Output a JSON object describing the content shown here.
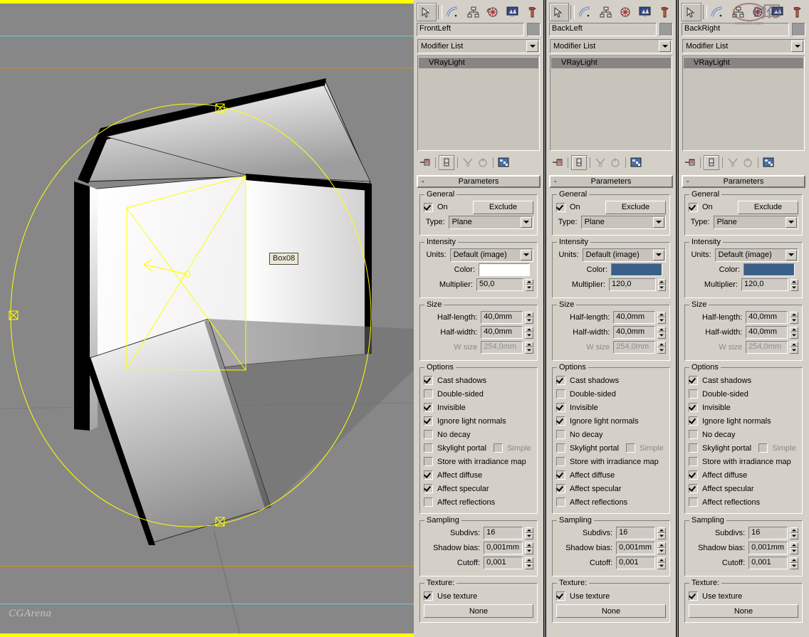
{
  "viewport": {
    "object_label": "Box08",
    "watermark": "CGArena",
    "background_color": "#878787",
    "border_color": "#ffff00",
    "safeframe_cyan": "#52d3d3",
    "safeframe_orange": "#c98f22",
    "gizmo_color": "#ffff00"
  },
  "watermark_overlay": {
    "text": "www.tt3.com",
    "alt": "chinese-site-watermark"
  },
  "toolbar": {
    "icons": [
      {
        "name": "create-panel-icon",
        "title": "Create"
      },
      {
        "name": "modify-panel-icon",
        "title": "Modify"
      },
      {
        "name": "hierarchy-panel-icon",
        "title": "Hierarchy"
      },
      {
        "name": "motion-panel-icon",
        "title": "Motion"
      },
      {
        "name": "display-panel-icon",
        "title": "Display"
      },
      {
        "name": "utilities-panel-icon",
        "title": "Utilities"
      }
    ]
  },
  "stack_toolbar": {
    "icons": [
      {
        "name": "pin-stack-icon",
        "title": "Pin Stack"
      },
      {
        "name": "show-end-result-icon",
        "title": "Show End Result"
      },
      {
        "name": "make-unique-icon",
        "title": "Make Unique"
      },
      {
        "name": "remove-modifier-icon",
        "title": "Remove Modifier"
      },
      {
        "name": "configure-modifier-sets-icon",
        "title": "Configure Modifier Sets"
      }
    ]
  },
  "labels": {
    "modifier_list": "Modifier List",
    "stack_entry": "VRayLight",
    "rollout_title": "Parameters",
    "rollout_minus": "-",
    "group_general": "General",
    "group_intensity": "Intensity",
    "group_size": "Size",
    "group_options": "Options",
    "group_sampling": "Sampling",
    "group_texture": "Texture:",
    "on": "On",
    "exclude": "Exclude",
    "type": "Type:",
    "units": "Units:",
    "color": "Color:",
    "multiplier": "Multiplier:",
    "half_length": "Half-length:",
    "half_width": "Half-width:",
    "w_size": "W size",
    "subdivs": "Subdivs:",
    "shadow_bias": "Shadow bias:",
    "cutoff": "Cutoff:",
    "use_texture": "Use texture",
    "none": "None",
    "opt_cast_shadows": "Cast shadows",
    "opt_double_sided": "Double-sided",
    "opt_invisible": "Invisible",
    "opt_ignore_light_normals": "Ignore light normals",
    "opt_no_decay": "No decay",
    "opt_skylight_portal": "Skylight portal",
    "opt_simple": "Simple",
    "opt_store_irradiance": "Store with irradiance map",
    "opt_affect_diffuse": "Affect diffuse",
    "opt_affect_specular": "Affect specular",
    "opt_affect_reflections": "Affect reflections"
  },
  "panels": [
    {
      "object_name": "FrontLeft",
      "on": true,
      "type": "Plane",
      "units": "Default (image)",
      "color": "#ffffff",
      "multiplier": "50,0",
      "half_length": "40,0mm",
      "half_width": "40,0mm",
      "w_size": "254,0mm",
      "options": {
        "cast_shadows": true,
        "double_sided": false,
        "invisible": true,
        "ignore_light_normals": true,
        "no_decay": false,
        "skylight_portal": false,
        "simple": false,
        "store_with_irradiance_map": false,
        "affect_diffuse": true,
        "affect_specular": true,
        "affect_reflections": false
      },
      "subdivs": "16",
      "shadow_bias": "0,001mm",
      "cutoff": "0,001",
      "use_texture": true,
      "texture": "None"
    },
    {
      "object_name": "BackLeft",
      "on": true,
      "type": "Plane",
      "units": "Default (image)",
      "color": "#3a5f8a",
      "multiplier": "120,0",
      "half_length": "40,0mm",
      "half_width": "40,0mm",
      "w_size": "254,0mm",
      "options": {
        "cast_shadows": true,
        "double_sided": false,
        "invisible": true,
        "ignore_light_normals": true,
        "no_decay": false,
        "skylight_portal": false,
        "simple": false,
        "store_with_irradiance_map": false,
        "affect_diffuse": true,
        "affect_specular": true,
        "affect_reflections": false
      },
      "subdivs": "16",
      "shadow_bias": "0,001mm",
      "cutoff": "0,001",
      "use_texture": true,
      "texture": "None"
    },
    {
      "object_name": "BackRight",
      "on": true,
      "type": "Plane",
      "units": "Default (image)",
      "color": "#3a5f8a",
      "multiplier": "120,0",
      "half_length": "40,0mm",
      "half_width": "40,0mm",
      "w_size": "254,0mm",
      "options": {
        "cast_shadows": true,
        "double_sided": false,
        "invisible": true,
        "ignore_light_normals": true,
        "no_decay": false,
        "skylight_portal": false,
        "simple": false,
        "store_with_irradiance_map": false,
        "affect_diffuse": true,
        "affect_specular": true,
        "affect_reflections": false
      },
      "subdivs": "16",
      "shadow_bias": "0,001mm",
      "cutoff": "0,001",
      "use_texture": true,
      "texture": "None"
    }
  ]
}
